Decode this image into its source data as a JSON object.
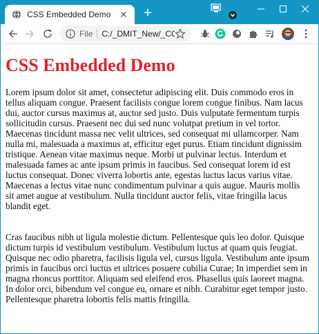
{
  "tab": {
    "title": "CSS Embedded Demo",
    "close_glyph": "✕"
  },
  "new_tab_glyph": "+",
  "address_bar": {
    "scheme_label": "File",
    "url": "C:/_DMIT_New/_CO..."
  },
  "page": {
    "heading": "CSS Embedded Demo",
    "heading_color": "#e0232b",
    "paragraphs": [
      "Lorem ipsum dolor sit amet, consectetur adipiscing elit. Duis commodo eros in tellus aliquam congue. Praesent facilisis congue lorem congue finibus. Nam lacus dui, auctor cursus maximus at, auctor sed justo. Duis vulputate fermentum turpis sollicitudin cursus. Praesent nec dui sed nunc volutpat pretium in vel tortor. Maecenas tincidunt massa nec velit ultrices, sed consequat mi ullamcorper. Nam nulla mi, malesuada a maximus at, efficitur eget purus. Etiam tincidunt dignissim tristique. Aenean vitae maximus neque. Morbi ut pulvinar lectus. Interdum et malesuada fames ac ante ipsum primis in faucibus. Sed consequat lorem id est luctus consequat. Donec viverra lobortis ante, egestas luctus lacus varius vitae. Maecenas a lectus vitae nunc condimentum pulvinar a quis augue. Mauris mollis sit amet augue at vestibulum. Nulla tincidunt auctor felis, vitae fringilla lacus blandit eget.",
      "Cras faucibus nibh ut ligula molestie dictum. Pellentesque quis leo dolor. Quisque dictum turpis id vestibulum vestibulum. Vestibulum luctus at quam quis feugiat. Quisque nec odio pharetra, facilisis ligula vel, cursus ligula. Vestibulum ante ipsum primis in faucibus orci luctus et ultrices posuere cubilia Curae; In imperdiet sem in magna rhoncus porttitor. Aliquam sed eleifend eros. Phasellus quis laoreet magna. In dolor orci, bibendum vel congue eu, ornare et nibh. Curabitur eget tempor justo. Pellentesque pharetra lobortis felis mattis fringilla."
    ]
  },
  "colors": {
    "titlebar": "#1497c6",
    "toolbar": "#ffffff",
    "omnibox": "#f1f3f4"
  },
  "icons": {
    "favicon": "globe-icon",
    "back": "arrow-left-icon",
    "forward": "arrow-right-icon",
    "reload": "reload-icon",
    "info": "info-icon",
    "bookmark": "star-icon",
    "extensions": [
      "bug-icon",
      "grammarly-icon",
      "circle-extension-icon",
      "puzzle-icon",
      "media-queue-icon"
    ],
    "avatar": "profile-avatar",
    "menu": "kebab-menu-icon"
  }
}
